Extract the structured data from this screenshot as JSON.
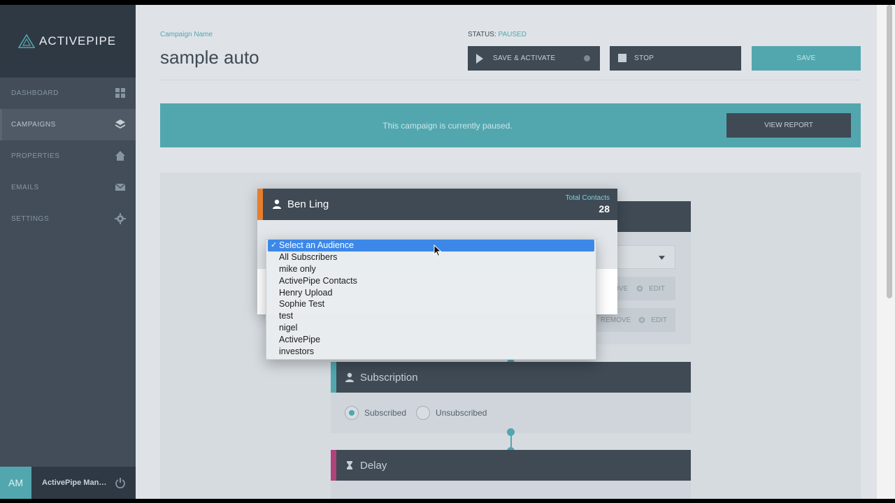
{
  "sidebar": {
    "logo": "ACTIVEPIPE",
    "items": [
      {
        "label": "DASHBOARD",
        "icon": "grid-icon"
      },
      {
        "label": "CAMPAIGNS",
        "icon": "layers-icon",
        "active": true
      },
      {
        "label": "PROPERTIES",
        "icon": "home-icon"
      },
      {
        "label": "EMAILS",
        "icon": "envelope-icon"
      },
      {
        "label": "SETTINGS",
        "icon": "gear-icon"
      }
    ],
    "footer": {
      "initials": "AM",
      "user": "ActivePipe Manag...",
      "icon": "power-icon"
    }
  },
  "header": {
    "campaign_label": "Campaign Name",
    "campaign_name": "sample auto",
    "status_label": "STATUS:",
    "status_value": "PAUSED",
    "save_activate": "SAVE & ACTIVATE",
    "stop": "STOP",
    "save": "SAVE"
  },
  "banner": {
    "text": "This campaign is currently paused.",
    "report_button": "VIEW REPORT"
  },
  "cards": {
    "audience_rule_1": {
      "remove": "OVE",
      "edit": "EDIT"
    },
    "audience_rule_2": {
      "remove": "REMOVE",
      "edit": "EDIT"
    },
    "subscription": {
      "title": "Subscription",
      "options": [
        "Subscribed",
        "Unsubscribed"
      ],
      "selected": "Subscribed"
    },
    "delay": {
      "title": "Delay"
    }
  },
  "modal": {
    "title": "Ben Ling",
    "total_label": "Total Contacts",
    "total_count": "28"
  },
  "dropdown": {
    "options": [
      "Select an Audience",
      "All Subscribers",
      "mike only",
      "ActivePipe Contacts",
      "Henry Upload",
      "Sophie Test",
      "test",
      "nigel",
      "ActivePipe",
      "investors"
    ],
    "selected": "Select an Audience"
  },
  "colors": {
    "accent": "#52a7af",
    "dark": "#3f4a55",
    "sidebar": "#424d59",
    "modal_accent": "#e67e2e",
    "subscription_accent": "#52a7af",
    "delay_accent": "#b0437a",
    "selection": "#3c88e8"
  }
}
